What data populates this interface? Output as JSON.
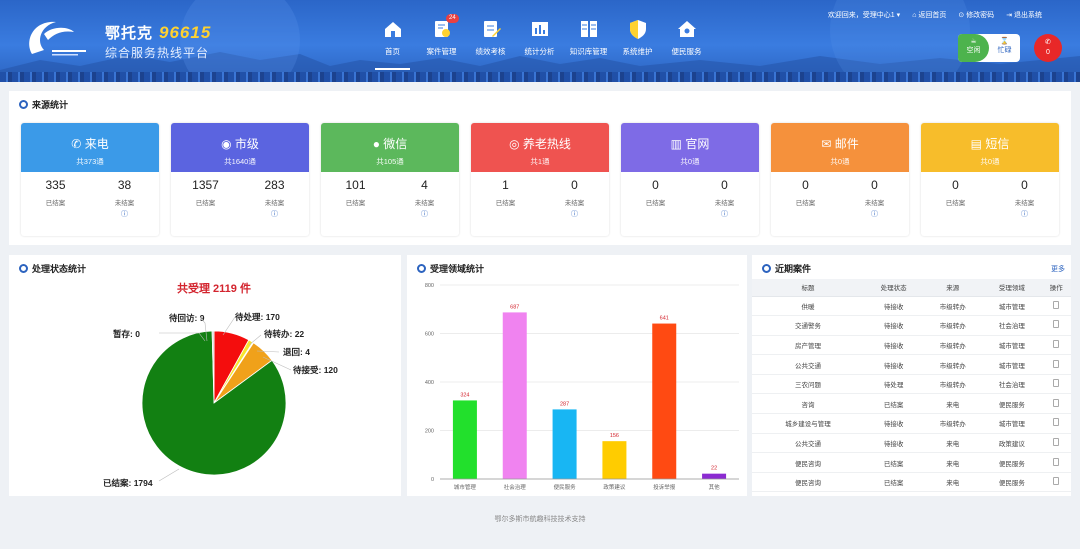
{
  "header": {
    "brand_name": "鄂托克",
    "hotline": "96615",
    "brand_sub": "综合服务热线平台",
    "nav": [
      {
        "label": "首页",
        "icon": "home-icon",
        "active": true
      },
      {
        "label": "案件管理",
        "icon": "case-icon",
        "badge": "24"
      },
      {
        "label": "绩效考核",
        "icon": "edit-icon"
      },
      {
        "label": "统计分析",
        "icon": "chart-icon"
      },
      {
        "label": "知识库管理",
        "icon": "knowledge-icon"
      },
      {
        "label": "系统维护",
        "icon": "shield-icon"
      },
      {
        "label": "便民服务",
        "icon": "house-icon"
      }
    ],
    "welcome": "欢迎回来，受理中心1",
    "links": [
      "返回首页",
      "修改密码",
      "退出系统"
    ],
    "status_free": "空闲",
    "status_busy": "忙碌",
    "hangup": "0"
  },
  "source": {
    "title": "来源统计",
    "cards": [
      {
        "name": "来电",
        "total": "共373通",
        "color": "#3b9ae8",
        "handled": "335",
        "unhandled": "38",
        "icon": "phone-icon"
      },
      {
        "name": "市级",
        "total": "共1640通",
        "color": "#5b64e0",
        "handled": "1357",
        "unhandled": "283",
        "icon": "globe-icon"
      },
      {
        "name": "微信",
        "total": "共105通",
        "color": "#5cb85c",
        "handled": "101",
        "unhandled": "4",
        "icon": "wechat-icon"
      },
      {
        "name": "养老热线",
        "total": "共1通",
        "color": "#ef5350",
        "handled": "1",
        "unhandled": "0",
        "icon": "weibo-icon"
      },
      {
        "name": "官网",
        "total": "共0通",
        "color": "#7e6be6",
        "handled": "0",
        "unhandled": "0",
        "icon": "building-icon"
      },
      {
        "name": "邮件",
        "total": "共0通",
        "color": "#f5913c",
        "handled": "0",
        "unhandled": "0",
        "icon": "mail-icon"
      },
      {
        "name": "短信",
        "total": "共0通",
        "color": "#f7bd2b",
        "handled": "0",
        "unhandled": "0",
        "icon": "sms-icon"
      }
    ],
    "handled_label": "已结案",
    "unhandled_label": "未结案"
  },
  "status_panel": {
    "title": "处理状态统计",
    "summary": "共受理 2119 件",
    "slices": [
      {
        "label": "已结案",
        "value": 1794,
        "color": "#128012"
      },
      {
        "label": "待处理",
        "value": 170,
        "color": "#f40d0d"
      },
      {
        "label": "待转办",
        "value": 22,
        "color": "#f7e62c"
      },
      {
        "label": "退回",
        "value": 4,
        "color": "#f3b3b3"
      },
      {
        "label": "待接受",
        "value": 120,
        "color": "#f0a11a"
      },
      {
        "label": "待回访",
        "value": 9,
        "color": "#cfcfcf"
      },
      {
        "label": "暂存",
        "value": 0,
        "color": "#6c6cff"
      }
    ],
    "label_texts": {
      "pending_visit": "待回访: 9",
      "temp": "暂存: 0",
      "processing": "待处理: 170",
      "transfer": "待转办: 22",
      "returned": "退回: 4",
      "accept": "待接受: 120",
      "closed": "已结案: 1794"
    }
  },
  "field_panel": {
    "title": "受理领域统计"
  },
  "chart_data": {
    "type": "bar",
    "categories": [
      "城市管理",
      "社会治理",
      "便民服务",
      "政策建议",
      "投诉举报",
      "其他"
    ],
    "values": [
      324,
      687,
      287,
      156,
      641,
      22
    ],
    "colors": [
      "#22e02c",
      "#f083f0",
      "#18b6f3",
      "#ffcc00",
      "#ff4a12",
      "#8b2bd1"
    ],
    "ylim": [
      0,
      800
    ],
    "yticks": [
      0,
      200,
      400,
      600,
      800
    ]
  },
  "cases": {
    "title": "近期案件",
    "more": "更多",
    "headers": [
      "标题",
      "处理状态",
      "来源",
      "受理领域",
      "操作"
    ],
    "rows": [
      [
        "供暖",
        "待接收",
        "市级转办",
        "城市管理"
      ],
      [
        "交通警务",
        "待接收",
        "市级转办",
        "社会治理"
      ],
      [
        "房产管理",
        "待接收",
        "市级转办",
        "城市管理"
      ],
      [
        "公共交通",
        "待接收",
        "市级转办",
        "城市管理"
      ],
      [
        "三农问题",
        "待处理",
        "市级转办",
        "社会治理"
      ],
      [
        "咨询",
        "已结案",
        "来电",
        "便民服务"
      ],
      [
        "城乡建设与管理",
        "待接收",
        "市级转办",
        "城市管理"
      ],
      [
        "公共交通",
        "待接收",
        "来电",
        "政策建议"
      ],
      [
        "便民咨询",
        "已结案",
        "来电",
        "便民服务"
      ],
      [
        "便民咨询",
        "已结案",
        "来电",
        "便民服务"
      ]
    ]
  },
  "footer": "鄂尔多斯市航趣科技技术支持"
}
